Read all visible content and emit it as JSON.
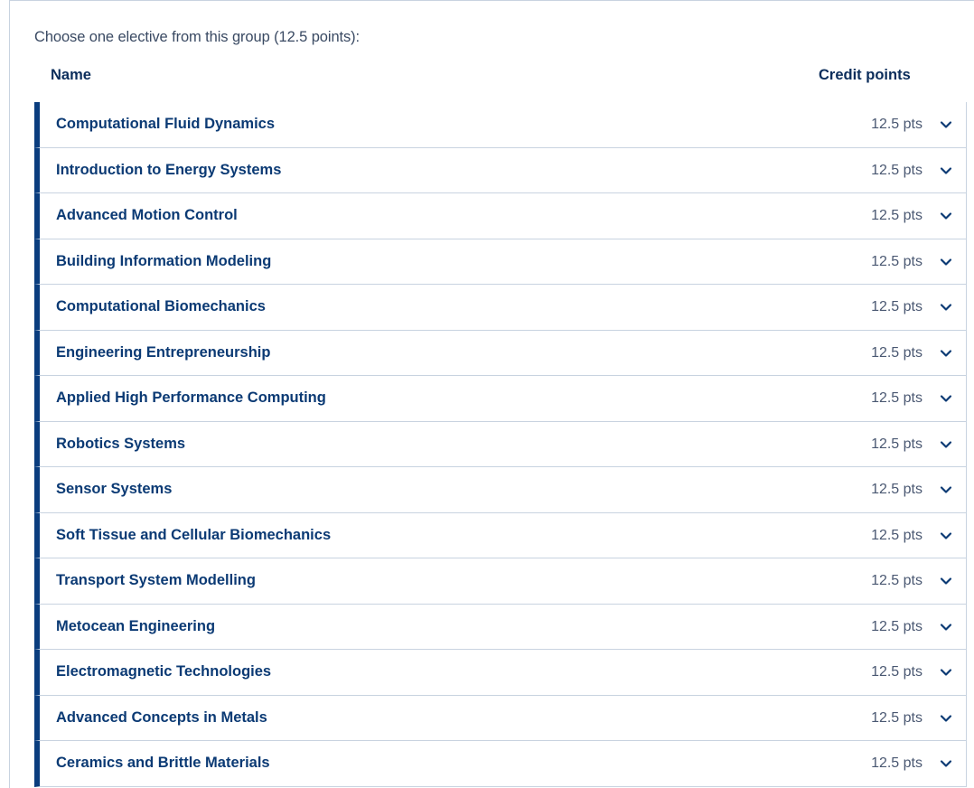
{
  "intro_text": "Choose one elective from this group (12.5 points):",
  "table": {
    "header_name": "Name",
    "header_credits": "Credit points"
  },
  "accent_color": "#0a3d7e",
  "expand_icon": "chevron-down-icon",
  "electives": [
    {
      "name": "Computational Fluid Dynamics",
      "credits": "12.5 pts"
    },
    {
      "name": "Introduction to Energy Systems",
      "credits": "12.5 pts"
    },
    {
      "name": "Advanced Motion Control",
      "credits": "12.5 pts"
    },
    {
      "name": "Building Information Modeling",
      "credits": "12.5 pts"
    },
    {
      "name": "Computational Biomechanics",
      "credits": "12.5 pts"
    },
    {
      "name": "Engineering Entrepreneurship",
      "credits": "12.5 pts"
    },
    {
      "name": "Applied High Performance Computing",
      "credits": "12.5 pts"
    },
    {
      "name": "Robotics Systems",
      "credits": "12.5 pts"
    },
    {
      "name": "Sensor Systems",
      "credits": "12.5 pts"
    },
    {
      "name": "Soft Tissue and Cellular Biomechanics",
      "credits": "12.5 pts"
    },
    {
      "name": "Transport System Modelling",
      "credits": "12.5 pts"
    },
    {
      "name": "Metocean Engineering",
      "credits": "12.5 pts"
    },
    {
      "name": "Electromagnetic Technologies",
      "credits": "12.5 pts"
    },
    {
      "name": "Advanced Concepts in Metals",
      "credits": "12.5 pts"
    },
    {
      "name": "Ceramics and Brittle Materials",
      "credits": "12.5 pts"
    }
  ]
}
